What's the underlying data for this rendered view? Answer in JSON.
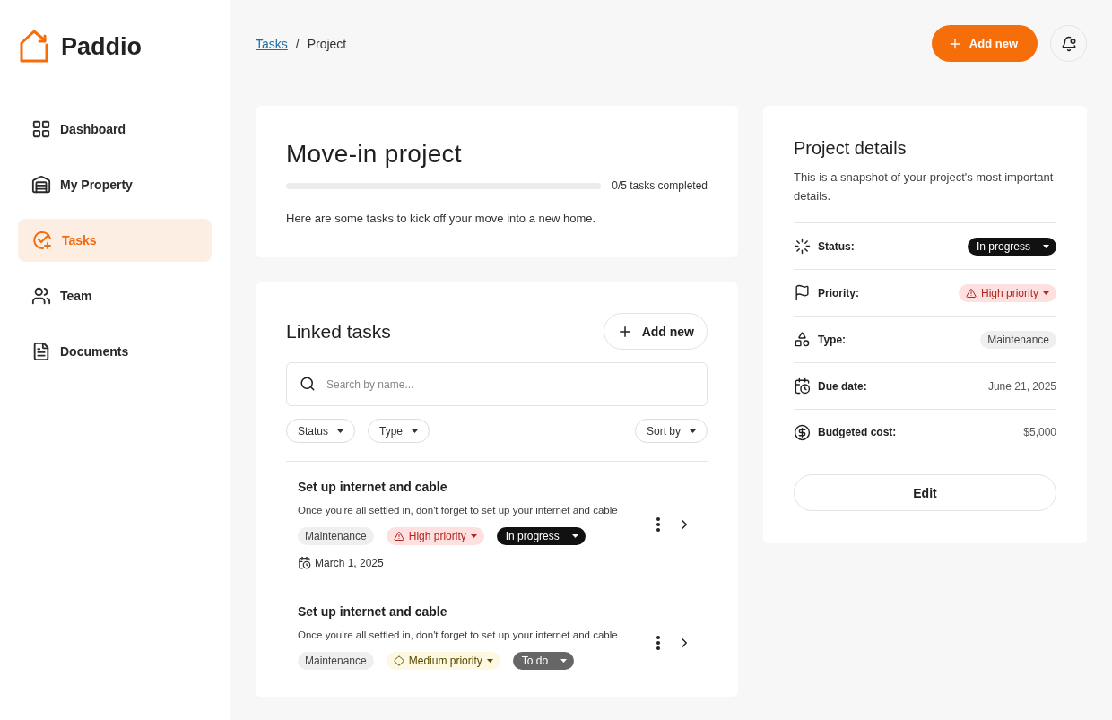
{
  "brand": {
    "name": "Paddio"
  },
  "sidebar": {
    "items": [
      {
        "label": "Dashboard",
        "selected": false
      },
      {
        "label": "My Property",
        "selected": false
      },
      {
        "label": "Tasks",
        "selected": true
      },
      {
        "label": "Team",
        "selected": false
      },
      {
        "label": "Documents",
        "selected": false
      }
    ]
  },
  "breadcrumb": {
    "link": "Tasks",
    "separator": "/",
    "current": "Project"
  },
  "header": {
    "add_button": "Add new"
  },
  "project": {
    "title": "Move-in project",
    "progress": {
      "level": 0,
      "reading": "0/5 tasks completed"
    },
    "description": "Here are some tasks to kick off your move into a new home."
  },
  "linked_tasks": {
    "title": "Linked tasks",
    "add_button": "Add new",
    "search": {
      "placeholder": "Search by name..."
    },
    "filters": [
      "Status",
      "Type"
    ],
    "sort": "Sort by",
    "tasks": [
      {
        "title": "Set up internet and cable",
        "description": "Once you're all settled in, don't forget to set up your internet and cable",
        "type": "Maintenance",
        "priority": {
          "label": "High priority",
          "kind": "high"
        },
        "status": {
          "label": "In progress",
          "kind": "in_progress"
        },
        "due": "March 1, 2025"
      },
      {
        "title": "Set up internet and cable",
        "description": "Once you're all settled in, don't forget to set up your internet and cable",
        "type": "Maintenance",
        "priority": {
          "label": "Medium priority",
          "kind": "medium"
        },
        "status": {
          "label": "To do",
          "kind": "todo"
        }
      }
    ]
  },
  "details": {
    "title": "Project details",
    "subtitle": "This is a snapshot of your project's most important details.",
    "rows": [
      {
        "label": "Status:",
        "kind": "status",
        "value": {
          "label": "In progress",
          "kind": "in_progress"
        }
      },
      {
        "label": "Priority:",
        "kind": "priority",
        "value": {
          "label": "High priority",
          "kind": "high"
        }
      },
      {
        "label": "Type:",
        "kind": "type",
        "value": {
          "label": "Maintenance"
        }
      },
      {
        "label": "Due date:",
        "kind": "text",
        "value": {
          "label": "June 21, 2025"
        }
      },
      {
        "label": "Budgeted cost:",
        "kind": "text",
        "value": {
          "label": "$5,000"
        }
      }
    ],
    "edit_button": "Edit"
  }
}
